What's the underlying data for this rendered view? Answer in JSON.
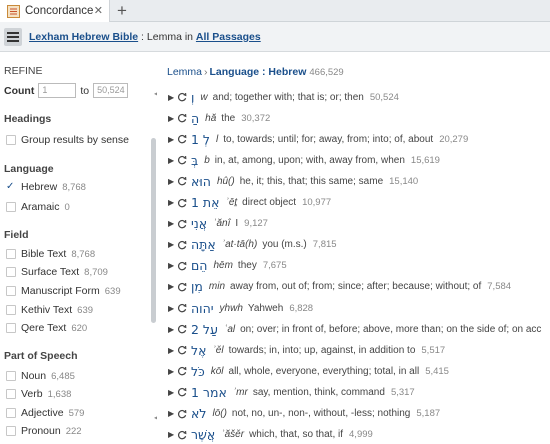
{
  "tab": {
    "label": "Concordance",
    "close": "✕",
    "new": "+"
  },
  "toolbar": {
    "resource": "Lexham Hebrew Bible",
    "colon": " : ",
    "kind": "Lemma",
    "in_word": " in ",
    "range": "All Passages"
  },
  "sidebar": {
    "refine": "REFINE",
    "count_label": "Count",
    "count_from": "1",
    "to_label": "to",
    "count_to": "50,524",
    "headings_title": "Headings",
    "group_label": "Group results by sense",
    "language_title": "Language",
    "language": [
      {
        "label": "Hebrew",
        "count": "8,768",
        "checked": true
      },
      {
        "label": "Aramaic",
        "count": "0",
        "checked": false
      }
    ],
    "field_title": "Field",
    "fields": [
      {
        "label": "Bible Text",
        "count": "8,768"
      },
      {
        "label": "Surface Text",
        "count": "8,709"
      },
      {
        "label": "Manuscript Form",
        "count": "639"
      },
      {
        "label": "Kethiv Text",
        "count": "639"
      },
      {
        "label": "Qere Text",
        "count": "620"
      }
    ],
    "pos_title": "Part of Speech",
    "pos": [
      {
        "label": "Noun",
        "count": "6,485"
      },
      {
        "label": "Verb",
        "count": "1,638"
      },
      {
        "label": "Adjective",
        "count": "579"
      },
      {
        "label": "Pronoun",
        "count": "222"
      }
    ]
  },
  "breadcrumb": {
    "root": "Lemma",
    "sep": "›",
    "current": "Language : Hebrew",
    "total": "466,529"
  },
  "rows": [
    {
      "lemma": "וְ",
      "translit": "w",
      "gloss": "and; together with; that is; or; then",
      "count": "50,524"
    },
    {
      "lemma": "הַ",
      "translit": "hă",
      "gloss": "the",
      "count": "30,372"
    },
    {
      "lemma": "לְ 1",
      "translit": "l",
      "gloss": "to, towards; until; for; away, from; into; of, about",
      "count": "20,279"
    },
    {
      "lemma": "בְּ",
      "translit": "b",
      "gloss": "in, at, among, upon; with, away from, when",
      "count": "15,619"
    },
    {
      "lemma": "הוּא",
      "translit": "hû()",
      "gloss": "he, it; this, that; this same; same",
      "count": "15,140"
    },
    {
      "lemma": "אֵת 1",
      "translit": "ʾēṯ",
      "gloss": "direct object",
      "count": "10,977"
    },
    {
      "lemma": "אֲנִי",
      "translit": "ʾănî",
      "gloss": "I",
      "count": "9,127"
    },
    {
      "lemma": "אַתָּה",
      "translit": "ʾat·tā(h)",
      "gloss": "you (m.s.)",
      "count": "7,815"
    },
    {
      "lemma": "הֵם",
      "translit": "hēm",
      "gloss": "they",
      "count": "7,675"
    },
    {
      "lemma": "מִן",
      "translit": "min",
      "gloss": "away from, out of; from; since; after; because; without; of",
      "count": "7,584"
    },
    {
      "lemma": "יהוה",
      "translit": "yhwh",
      "gloss": "Yahweh",
      "count": "6,828"
    },
    {
      "lemma": "עַל 2",
      "translit": "ʿal",
      "gloss": "on; over; in front of, before; above, more than; on the side of; on acc",
      "count": ""
    },
    {
      "lemma": "אֶל",
      "translit": "ʾĕl",
      "gloss": "towards; in, into; up, against, in addition to",
      "count": "5,517"
    },
    {
      "lemma": "כֹּל",
      "translit": "kōl",
      "gloss": "all, whole, everyone, everything; total, in all",
      "count": "5,415"
    },
    {
      "lemma": "אמר 1",
      "translit": "ʾmr",
      "gloss": "say, mention, think, command",
      "count": "5,317"
    },
    {
      "lemma": "לֹא",
      "translit": "lō()",
      "gloss": "not, no, un-, non-, without, -less; nothing",
      "count": "5,187"
    },
    {
      "lemma": "אֲשֶׁר",
      "translit": "ʾăšĕr",
      "gloss": "which, that, so that, if",
      "count": "4,999"
    }
  ],
  "colors": {
    "link": "#1a4f8b",
    "toolbar_bg": "#f1f3f5",
    "tabbar_bg": "#e9ecef"
  }
}
